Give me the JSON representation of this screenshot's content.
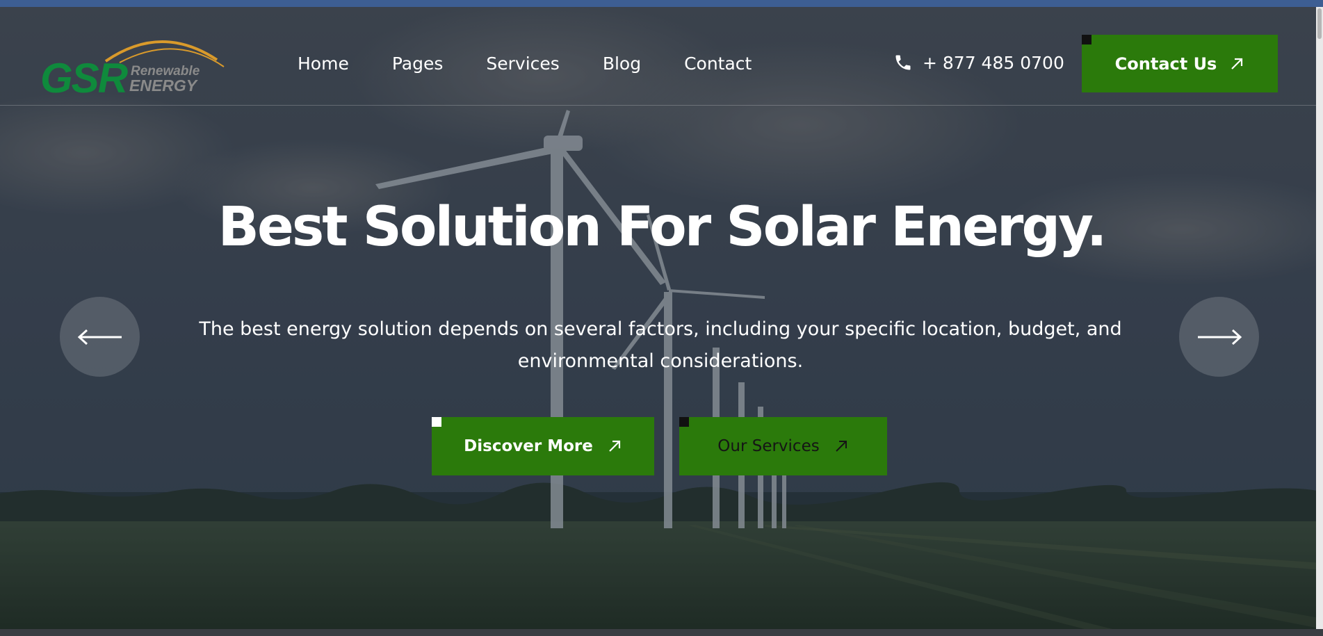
{
  "logo": {
    "main": "GSR",
    "line1": "Renewable",
    "line2": "ENERGY"
  },
  "nav": {
    "items": [
      "Home",
      "Pages",
      "Services",
      "Blog",
      "Contact"
    ]
  },
  "phone": {
    "number": "+ 877 485 0700",
    "icon": "phone-icon"
  },
  "header_cta": {
    "label": "Contact Us",
    "icon": "arrow-up-right-icon"
  },
  "hero": {
    "title": "Best Solution For Solar Energy.",
    "subtitle": "The best energy solution depends on several factors, including your specific location, budget, and environmental considerations.",
    "primary_button": "Discover More",
    "secondary_button": "Our Services",
    "prev_icon": "arrow-left-icon",
    "next_icon": "arrow-right-icon"
  },
  "colors": {
    "accent_green": "#2b7a0b",
    "logo_green": "#0f8a3c",
    "logo_arc": "#d99a2b",
    "overlay": "#2b3440"
  }
}
